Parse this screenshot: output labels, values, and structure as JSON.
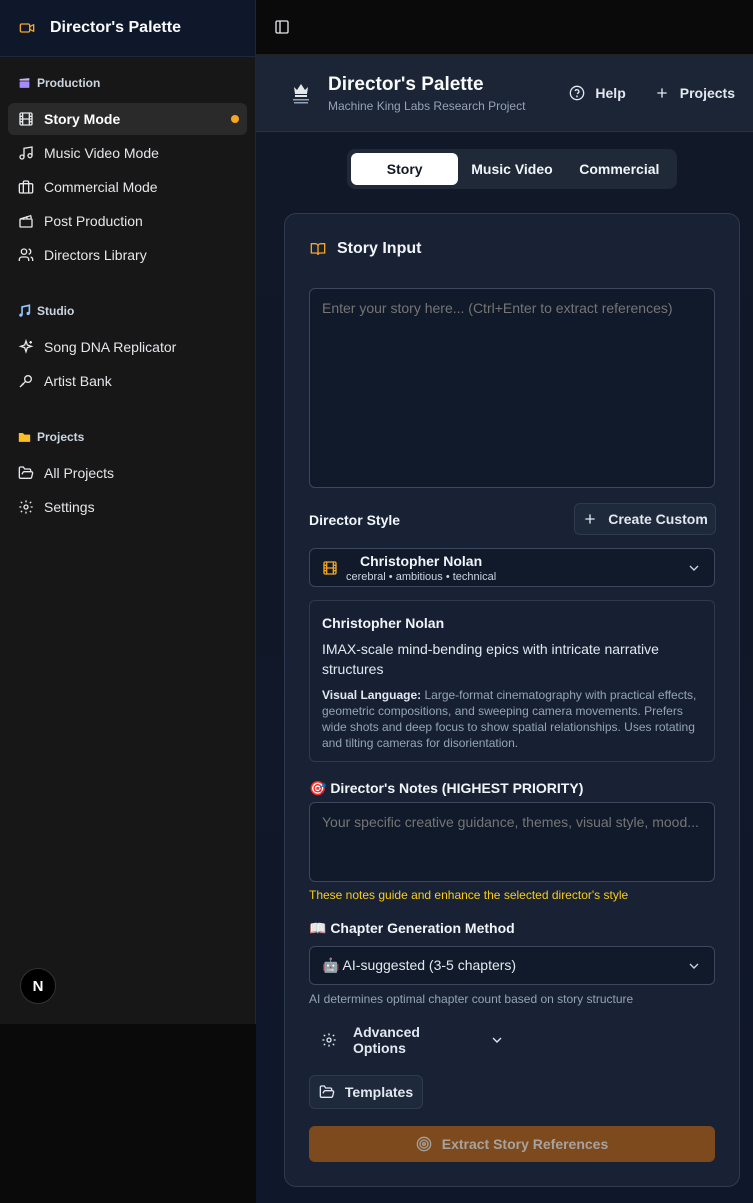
{
  "sidebar": {
    "app_title": "Director's Palette",
    "groups": [
      {
        "label": "Production",
        "items": [
          {
            "label": "Story Mode"
          },
          {
            "label": "Music Video Mode"
          },
          {
            "label": "Commercial Mode"
          },
          {
            "label": "Post Production"
          },
          {
            "label": "Directors Library"
          }
        ]
      },
      {
        "label": "Studio",
        "items": [
          {
            "label": "Song DNA Replicator"
          },
          {
            "label": "Artist Bank"
          }
        ]
      },
      {
        "label": "Projects",
        "items": [
          {
            "label": "All Projects"
          },
          {
            "label": "Settings"
          }
        ]
      }
    ],
    "badge_letter": "N",
    "accent_color": "#f5a623"
  },
  "header": {
    "title": "Director's Palette",
    "subtitle": "Machine King Labs Research Project",
    "help_label": "Help",
    "projects_label": "Projects"
  },
  "tabs": [
    {
      "label": "Story",
      "active": true
    },
    {
      "label": "Music Video",
      "active": false
    },
    {
      "label": "Commercial",
      "active": false
    }
  ],
  "story": {
    "card_title": "Story Input",
    "story_placeholder": "Enter your story here... (Ctrl+Enter to extract references)",
    "director_style_label": "Director Style",
    "create_custom_label": "Create Custom",
    "selected_director": {
      "name": "Christopher Nolan",
      "tags": "cerebral • ambitious • technical"
    },
    "director_info": {
      "name": "Christopher Nolan",
      "description": "IMAX-scale mind-bending epics with intricate narrative structures",
      "visual_language_label": "Visual Language:",
      "visual_language": "Large-format cinematography with practical effects, geometric compositions, and sweeping camera movements. Prefers wide shots and deep focus to show spatial relationships. Uses rotating and tilting cameras for disorientation."
    },
    "notes_label": "🎯 Director's Notes (HIGHEST PRIORITY)",
    "notes_placeholder": "Your specific creative guidance, themes, visual style, mood...",
    "notes_hint": "These notes guide and enhance the selected director's style",
    "chapter_label": "📖 Chapter Generation Method",
    "chapter_selected": "🤖 AI-suggested (3-5 chapters)",
    "chapter_hint": "AI determines optimal chapter count based on story structure",
    "advanced_label": "Advanced Options",
    "templates_label": "Templates",
    "extract_label": "Extract Story References"
  }
}
